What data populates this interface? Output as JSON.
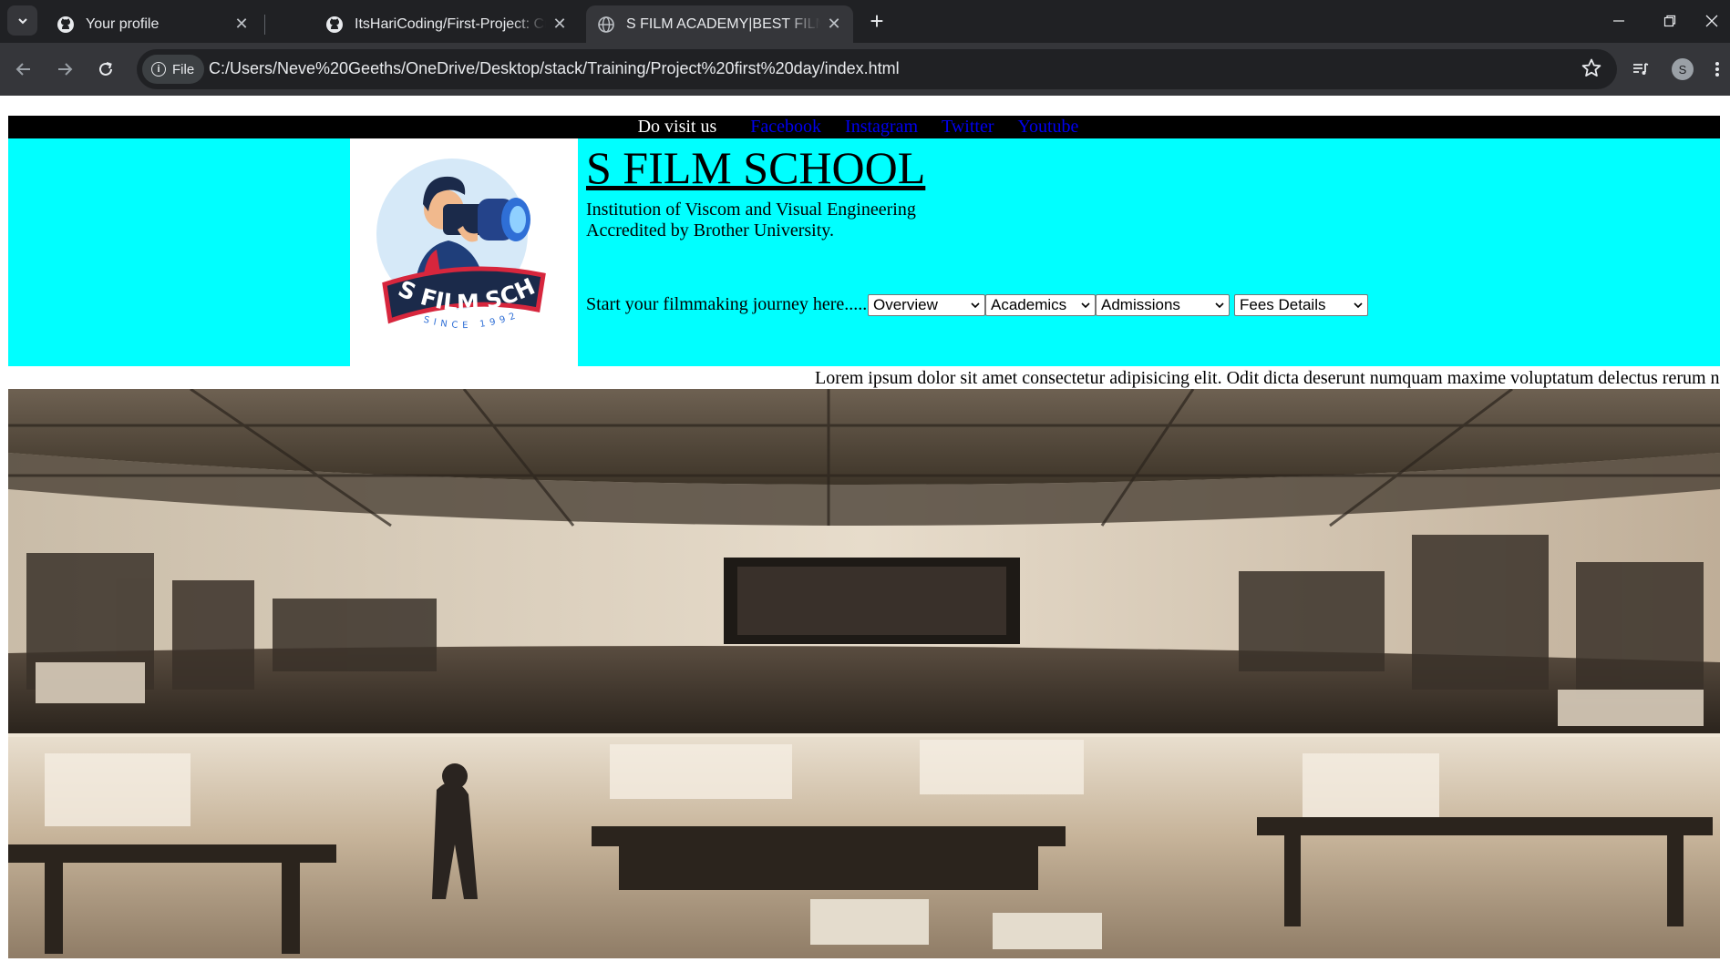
{
  "browser": {
    "tabs": [
      {
        "title": "Your profile",
        "icon": "github-icon"
      },
      {
        "title": "ItsHariCoding/First-Project: Cre",
        "icon": "github-icon"
      },
      {
        "title": "S FILM ACADEMY|BEST FILM M",
        "icon": "globe-icon",
        "active": true
      }
    ],
    "address": {
      "chip_label": "File",
      "url": "C:/Users/Neve%20Geeths/OneDrive/Desktop/stack/Training/Project%20first%20day/index.html"
    },
    "profile_initial": "S"
  },
  "page": {
    "topbar": {
      "label": "Do visit us",
      "links": [
        "Facebook",
        "Instagram",
        "Twitter",
        "Youtube"
      ]
    },
    "logo": {
      "text": "S FILM SCHOOL",
      "tagline": "SINCE 1992"
    },
    "school_title": "S FILM SCHOOL",
    "subtitle_1": "Institution of Viscom and Visual Engineering",
    "subtitle_2": "Accredited by Brother University.",
    "journey_text": "Start your filmmaking journey here......",
    "dropdowns": [
      "Overview",
      "Academics",
      "Admissions",
      "Fees Details"
    ],
    "marquee_text": "Lorem ipsum dolor sit amet consectetur adipisicing elit. Odit dicta deserunt numquam maxime voluptatum delectus rerum n",
    "hero_image": "film-studio-photo"
  },
  "colors": {
    "header_bg": "#00ffff",
    "topbar_bg": "#000000",
    "link": "#0000ee",
    "chrome_dark": "#202124",
    "chrome_mid": "#35363a"
  }
}
